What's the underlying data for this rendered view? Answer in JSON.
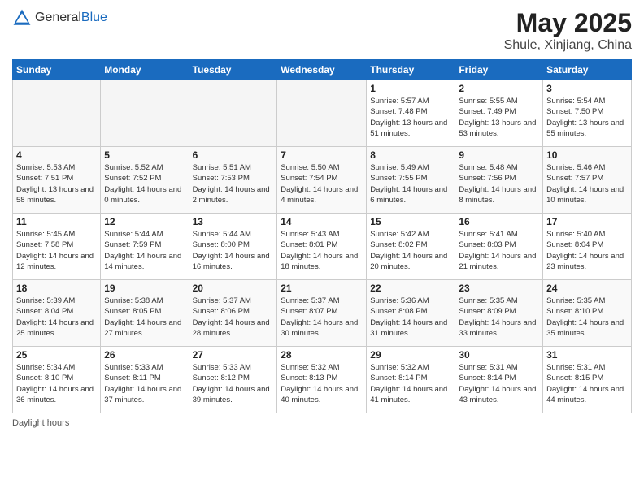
{
  "header": {
    "logo_general": "General",
    "logo_blue": "Blue",
    "main_title": "May 2025",
    "subtitle": "Shule, Xinjiang, China"
  },
  "calendar": {
    "days_of_week": [
      "Sunday",
      "Monday",
      "Tuesday",
      "Wednesday",
      "Thursday",
      "Friday",
      "Saturday"
    ],
    "weeks": [
      [
        {
          "day": "",
          "empty": true
        },
        {
          "day": "",
          "empty": true
        },
        {
          "day": "",
          "empty": true
        },
        {
          "day": "",
          "empty": true
        },
        {
          "day": "1",
          "sunrise": "5:57 AM",
          "sunset": "7:48 PM",
          "daylight": "13 hours and 51 minutes."
        },
        {
          "day": "2",
          "sunrise": "5:55 AM",
          "sunset": "7:49 PM",
          "daylight": "13 hours and 53 minutes."
        },
        {
          "day": "3",
          "sunrise": "5:54 AM",
          "sunset": "7:50 PM",
          "daylight": "13 hours and 55 minutes."
        }
      ],
      [
        {
          "day": "4",
          "sunrise": "5:53 AM",
          "sunset": "7:51 PM",
          "daylight": "13 hours and 58 minutes."
        },
        {
          "day": "5",
          "sunrise": "5:52 AM",
          "sunset": "7:52 PM",
          "daylight": "14 hours and 0 minutes."
        },
        {
          "day": "6",
          "sunrise": "5:51 AM",
          "sunset": "7:53 PM",
          "daylight": "14 hours and 2 minutes."
        },
        {
          "day": "7",
          "sunrise": "5:50 AM",
          "sunset": "7:54 PM",
          "daylight": "14 hours and 4 minutes."
        },
        {
          "day": "8",
          "sunrise": "5:49 AM",
          "sunset": "7:55 PM",
          "daylight": "14 hours and 6 minutes."
        },
        {
          "day": "9",
          "sunrise": "5:48 AM",
          "sunset": "7:56 PM",
          "daylight": "14 hours and 8 minutes."
        },
        {
          "day": "10",
          "sunrise": "5:46 AM",
          "sunset": "7:57 PM",
          "daylight": "14 hours and 10 minutes."
        }
      ],
      [
        {
          "day": "11",
          "sunrise": "5:45 AM",
          "sunset": "7:58 PM",
          "daylight": "14 hours and 12 minutes."
        },
        {
          "day": "12",
          "sunrise": "5:44 AM",
          "sunset": "7:59 PM",
          "daylight": "14 hours and 14 minutes."
        },
        {
          "day": "13",
          "sunrise": "5:44 AM",
          "sunset": "8:00 PM",
          "daylight": "14 hours and 16 minutes."
        },
        {
          "day": "14",
          "sunrise": "5:43 AM",
          "sunset": "8:01 PM",
          "daylight": "14 hours and 18 minutes."
        },
        {
          "day": "15",
          "sunrise": "5:42 AM",
          "sunset": "8:02 PM",
          "daylight": "14 hours and 20 minutes."
        },
        {
          "day": "16",
          "sunrise": "5:41 AM",
          "sunset": "8:03 PM",
          "daylight": "14 hours and 21 minutes."
        },
        {
          "day": "17",
          "sunrise": "5:40 AM",
          "sunset": "8:04 PM",
          "daylight": "14 hours and 23 minutes."
        }
      ],
      [
        {
          "day": "18",
          "sunrise": "5:39 AM",
          "sunset": "8:04 PM",
          "daylight": "14 hours and 25 minutes."
        },
        {
          "day": "19",
          "sunrise": "5:38 AM",
          "sunset": "8:05 PM",
          "daylight": "14 hours and 27 minutes."
        },
        {
          "day": "20",
          "sunrise": "5:37 AM",
          "sunset": "8:06 PM",
          "daylight": "14 hours and 28 minutes."
        },
        {
          "day": "21",
          "sunrise": "5:37 AM",
          "sunset": "8:07 PM",
          "daylight": "14 hours and 30 minutes."
        },
        {
          "day": "22",
          "sunrise": "5:36 AM",
          "sunset": "8:08 PM",
          "daylight": "14 hours and 31 minutes."
        },
        {
          "day": "23",
          "sunrise": "5:35 AM",
          "sunset": "8:09 PM",
          "daylight": "14 hours and 33 minutes."
        },
        {
          "day": "24",
          "sunrise": "5:35 AM",
          "sunset": "8:10 PM",
          "daylight": "14 hours and 35 minutes."
        }
      ],
      [
        {
          "day": "25",
          "sunrise": "5:34 AM",
          "sunset": "8:10 PM",
          "daylight": "14 hours and 36 minutes."
        },
        {
          "day": "26",
          "sunrise": "5:33 AM",
          "sunset": "8:11 PM",
          "daylight": "14 hours and 37 minutes."
        },
        {
          "day": "27",
          "sunrise": "5:33 AM",
          "sunset": "8:12 PM",
          "daylight": "14 hours and 39 minutes."
        },
        {
          "day": "28",
          "sunrise": "5:32 AM",
          "sunset": "8:13 PM",
          "daylight": "14 hours and 40 minutes."
        },
        {
          "day": "29",
          "sunrise": "5:32 AM",
          "sunset": "8:14 PM",
          "daylight": "14 hours and 41 minutes."
        },
        {
          "day": "30",
          "sunrise": "5:31 AM",
          "sunset": "8:14 PM",
          "daylight": "14 hours and 43 minutes."
        },
        {
          "day": "31",
          "sunrise": "5:31 AM",
          "sunset": "8:15 PM",
          "daylight": "14 hours and 44 minutes."
        }
      ]
    ]
  },
  "footer": {
    "daylight_label": "Daylight hours"
  }
}
